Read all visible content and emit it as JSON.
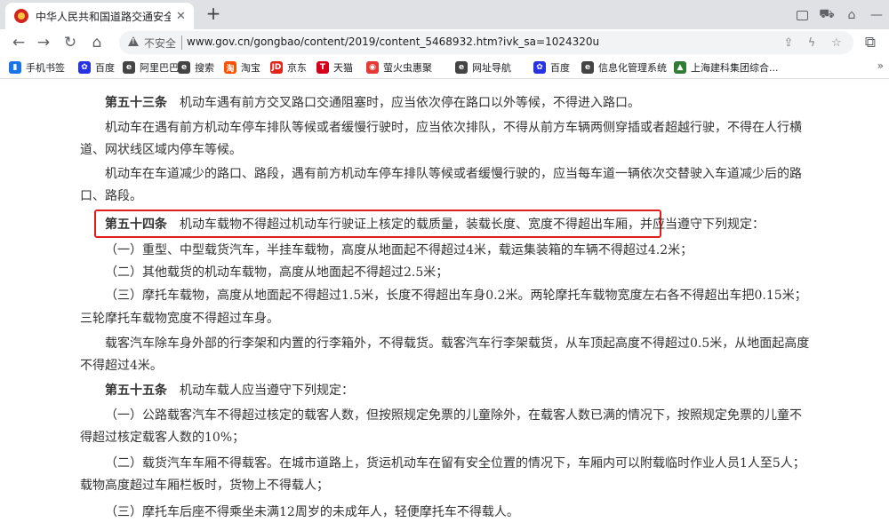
{
  "browser": {
    "tab": {
      "title": "中华人民共和国道路交通安全法实施条例"
    },
    "address": {
      "security_label": "不安全",
      "url": "www.gov.cn/gongbao/content/2019/content_5468932.htm?ivk_sa=1024320u"
    },
    "bookmarks": [
      {
        "label": "手机书签",
        "icon": "bookmark-icon",
        "color": "#1a73e8"
      },
      {
        "label": "百度",
        "icon": "baidu-icon",
        "color": "#2932e1"
      },
      {
        "label": "阿里巴巴",
        "icon": "alibaba-icon",
        "color": "#444444"
      },
      {
        "label": "搜索",
        "icon": "search-icon",
        "color": "#444444"
      },
      {
        "label": "淘宝",
        "icon": "taobao-icon",
        "color": "#ff5000"
      },
      {
        "label": "京东",
        "icon": "jd-icon",
        "color": "#e1251b"
      },
      {
        "label": "天猫",
        "icon": "tmall-icon",
        "color": "#d6001c"
      },
      {
        "label": "萤火虫惠聚",
        "icon": "firefly-icon",
        "color": "#e53935"
      },
      {
        "label": "网址导航",
        "icon": "nav-icon",
        "color": "#444444"
      },
      {
        "label": "百度",
        "icon": "baidu-icon",
        "color": "#2932e1"
      },
      {
        "label": "信息化管理系统",
        "icon": "globe-icon",
        "color": "#444444"
      },
      {
        "label": "上海建科集团综合...",
        "icon": "company-icon",
        "color": "#2e7d32"
      }
    ]
  },
  "article": {
    "paragraphs": [
      {
        "text": "第五十三条　机动车遇有前方交叉路口交通阻塞时，应当依次停在路口以外等候，不得进入路口。"
      },
      {
        "text": "机动车在遇有前方机动车停车排队等候或者缓慢行驶时，应当依次排队，不得从前方车辆两侧穿插或者超越行驶，不得在人行横"
      },
      {
        "text": "道、网状线区域内停车等候。"
      },
      {
        "text": "机动车在车道减少的路口、路段，遇有前方机动车停车排队等候或者缓慢行驶的，应当每车道一辆依次交替驶入车道减少后的路"
      },
      {
        "text": "口、路段。"
      },
      {
        "text": "第五十四条　机动车载物不得超过机动车行驶证上核定的载质量，装载长度、宽度不得超出车厢，并应当遵守下列规定："
      },
      {
        "text": "（一）重型、中型载货汽车，半挂车载物，高度从地面起不得超过4米，载运集装箱的车辆不得超过4.2米；"
      },
      {
        "text": "（二）其他载货的机动车载物，高度从地面起不得超过2.5米；"
      },
      {
        "text": "（三）摩托车载物，高度从地面起不得超过1.5米，长度不得超出车身0.2米。两轮摩托车载物宽度左右各不得超出车把0.15米；"
      },
      {
        "text": "三轮摩托车载物宽度不得超过车身。"
      },
      {
        "text": "载客汽车除车身外部的行李架和内置的行李箱外，不得载货。载客汽车行李架载货，从车顶起高度不得超过0.5米，从地面起高度"
      },
      {
        "text": "不得超过4米。"
      },
      {
        "text": "第五十五条　机动车载人应当遵守下列规定："
      },
      {
        "text": "（一）公路载客汽车不得超过核定的载客人数，但按照规定免票的儿童除外，在载客人数已满的情况下，按照规定免票的儿童不"
      },
      {
        "text": "得超过核定载客人数的10%；"
      },
      {
        "text": "（二）载货汽车车厢不得载客。在城市道路上，货运机动车在留有安全位置的情况下，车厢内可以附载临时作业人员1人至5人；"
      },
      {
        "text": "载物高度超过车厢栏板时，货物上不得载人；"
      },
      {
        "text": "（三）摩托车后座不得乘坐未满12周岁的未成年人，轻便摩托车不得载人。"
      }
    ]
  },
  "colors": {
    "highlight": "#e21b1b"
  }
}
